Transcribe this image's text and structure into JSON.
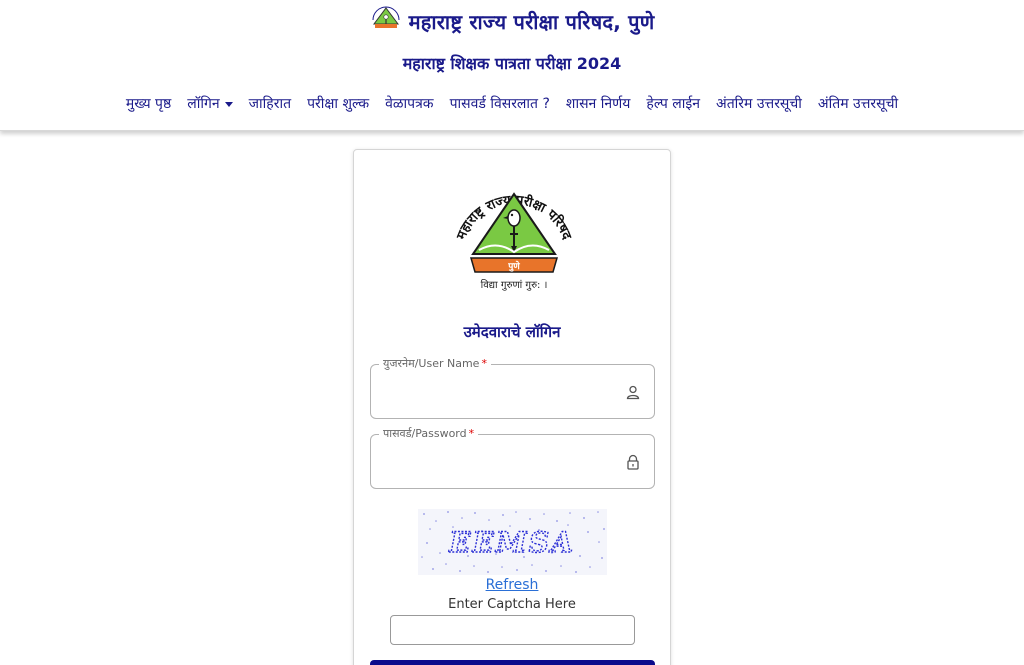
{
  "header": {
    "title": "महाराष्ट्र राज्य परीक्षा परिषद, पुणे",
    "subtitle": "महाराष्ट्र शिक्षक पात्रता परीक्षा 2024"
  },
  "nav": {
    "items": [
      {
        "label": "मुख्य पृष्ठ"
      },
      {
        "label": "लॉगिन"
      },
      {
        "label": "जाहिरात"
      },
      {
        "label": "परीक्षा शुल्क"
      },
      {
        "label": "वेळापत्रक"
      },
      {
        "label": "पासवर्ड विसरलात ?"
      },
      {
        "label": "शासन निर्णय"
      },
      {
        "label": "हेल्प लाईन"
      },
      {
        "label": "अंतरिम उत्तरसूची"
      },
      {
        "label": "अंतिम उत्तरसूची"
      }
    ]
  },
  "emblem": {
    "ring_text": "महाराष्ट्र राज्य परीक्षा परिषद",
    "city": "पुणे",
    "motto": "विद्या गुरुणां गुरु: ।"
  },
  "login": {
    "title": "उमेदवाराचे लॉगिन",
    "username": {
      "label": "युजरनेम/User Name",
      "required_mark": "*",
      "value": "",
      "icon": "user-icon"
    },
    "password": {
      "label": "पासवर्ड/Password",
      "required_mark": "*",
      "value": "",
      "icon": "lock-icon"
    },
    "captcha": {
      "text": "EEMSA",
      "refresh_label": "Refresh",
      "input_label": "Enter Captcha Here",
      "value": ""
    }
  },
  "colors": {
    "brand_navy": "#1a1a8a",
    "button_navy": "#0b0b8c",
    "link_blue": "#2a6fd6",
    "emblem_green": "#7ac943",
    "emblem_orange": "#e8742a"
  }
}
